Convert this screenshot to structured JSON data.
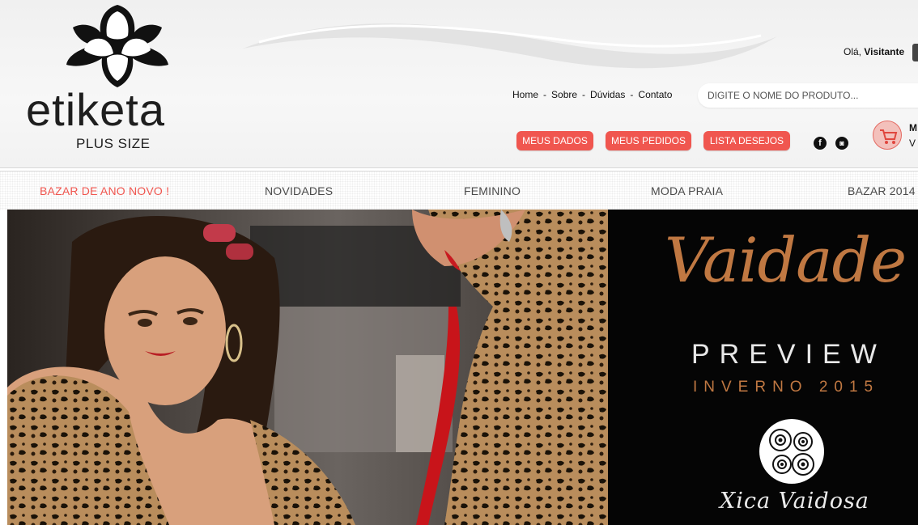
{
  "logo": {
    "brand": "etiketa",
    "sub": "PLUS SIZE"
  },
  "greeting": {
    "prefix": "Olá,",
    "name": "Visitante"
  },
  "topnav": {
    "home": "Home",
    "sobre": "Sobre",
    "duvidas": "Dúvidas",
    "contato": "Contato",
    "separator": "-"
  },
  "search": {
    "placeholder": "DIGITE O NOME DO PRODUTO..."
  },
  "account_buttons": {
    "meus_dados": "MEUS DADOS",
    "meus_pedidos": "MEUS PEDIDOS",
    "lista_desejos": "LISTA DESEJOS"
  },
  "social": {
    "facebook": "f",
    "instagram": "◙"
  },
  "cart": {
    "title": "M",
    "status": "V"
  },
  "categories": [
    {
      "label": "BAZAR DE ANO NOVO !"
    },
    {
      "label": "NOVIDADES"
    },
    {
      "label": "FEMININO"
    },
    {
      "label": "MODA PRAIA"
    },
    {
      "label": "BAZAR 2014"
    }
  ],
  "banner": {
    "title_script": "Vaidade",
    "preview": "PREVIEW",
    "season": "INVERNO 2015",
    "brand": "Xica Vaidosa"
  },
  "colors": {
    "accent": "#f0564f",
    "copper": "#c07842",
    "text": "#1e1e1e"
  }
}
